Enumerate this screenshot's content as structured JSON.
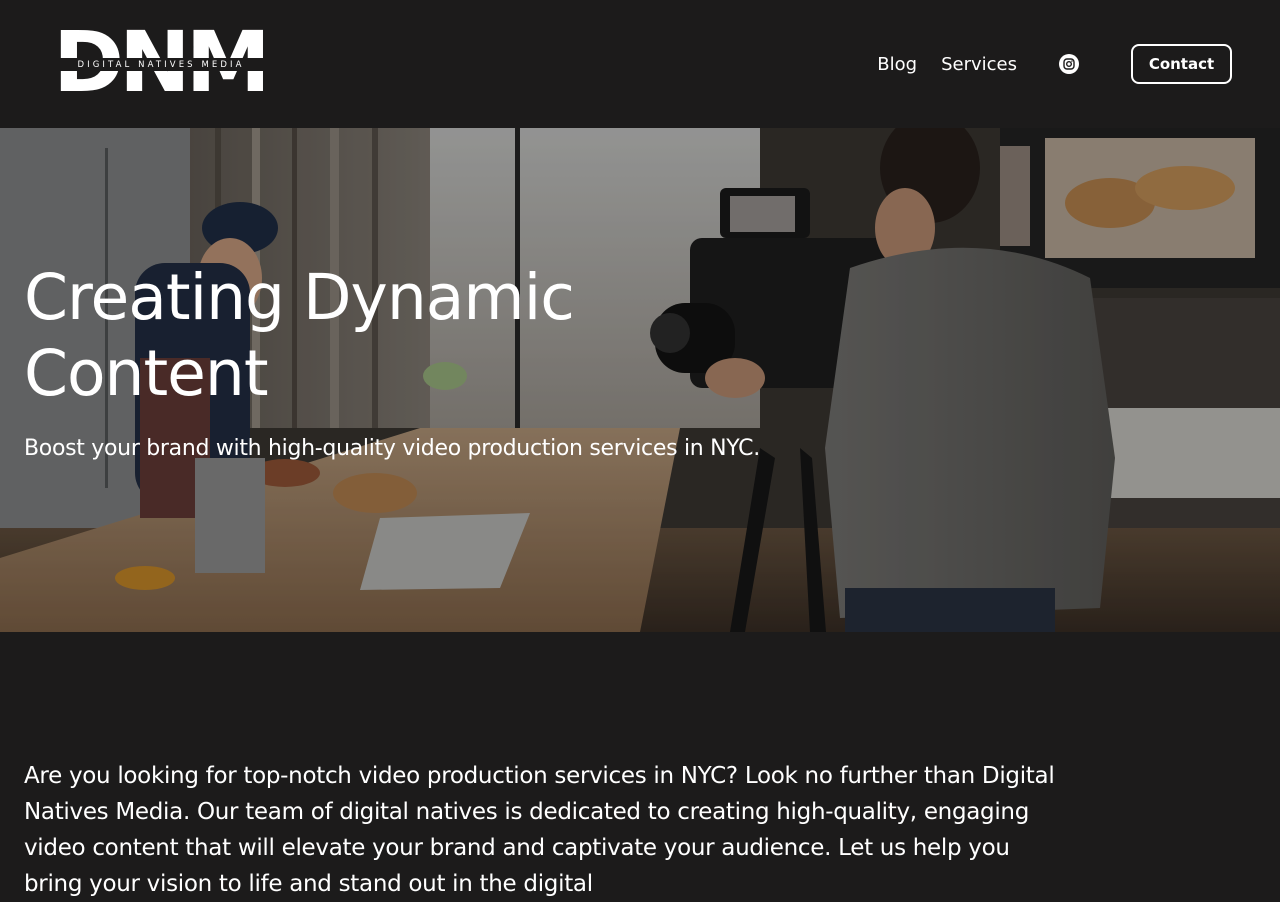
{
  "brand": {
    "logo_letters": "DNM",
    "tagline": "DIGITAL NATIVES MEDIA"
  },
  "nav": {
    "items": [
      {
        "label": "Blog"
      },
      {
        "label": "Services"
      }
    ],
    "social_icon": "instagram-icon",
    "contact_label": "Contact"
  },
  "hero": {
    "title": "Creating Dynamic Content",
    "subtitle": "Boost your brand with high-quality video production services in NYC."
  },
  "intro": {
    "text": "Are you looking for top-notch video production services in NYC? Look no further than Digital Natives Media. Our team of digital natives is dedicated to creating high-quality, engaging video content that will elevate your brand and captivate your audience. Let us help you bring your vision to life and stand out in the digital"
  },
  "colors": {
    "background": "#1c1b1b",
    "text": "#ffffff"
  }
}
